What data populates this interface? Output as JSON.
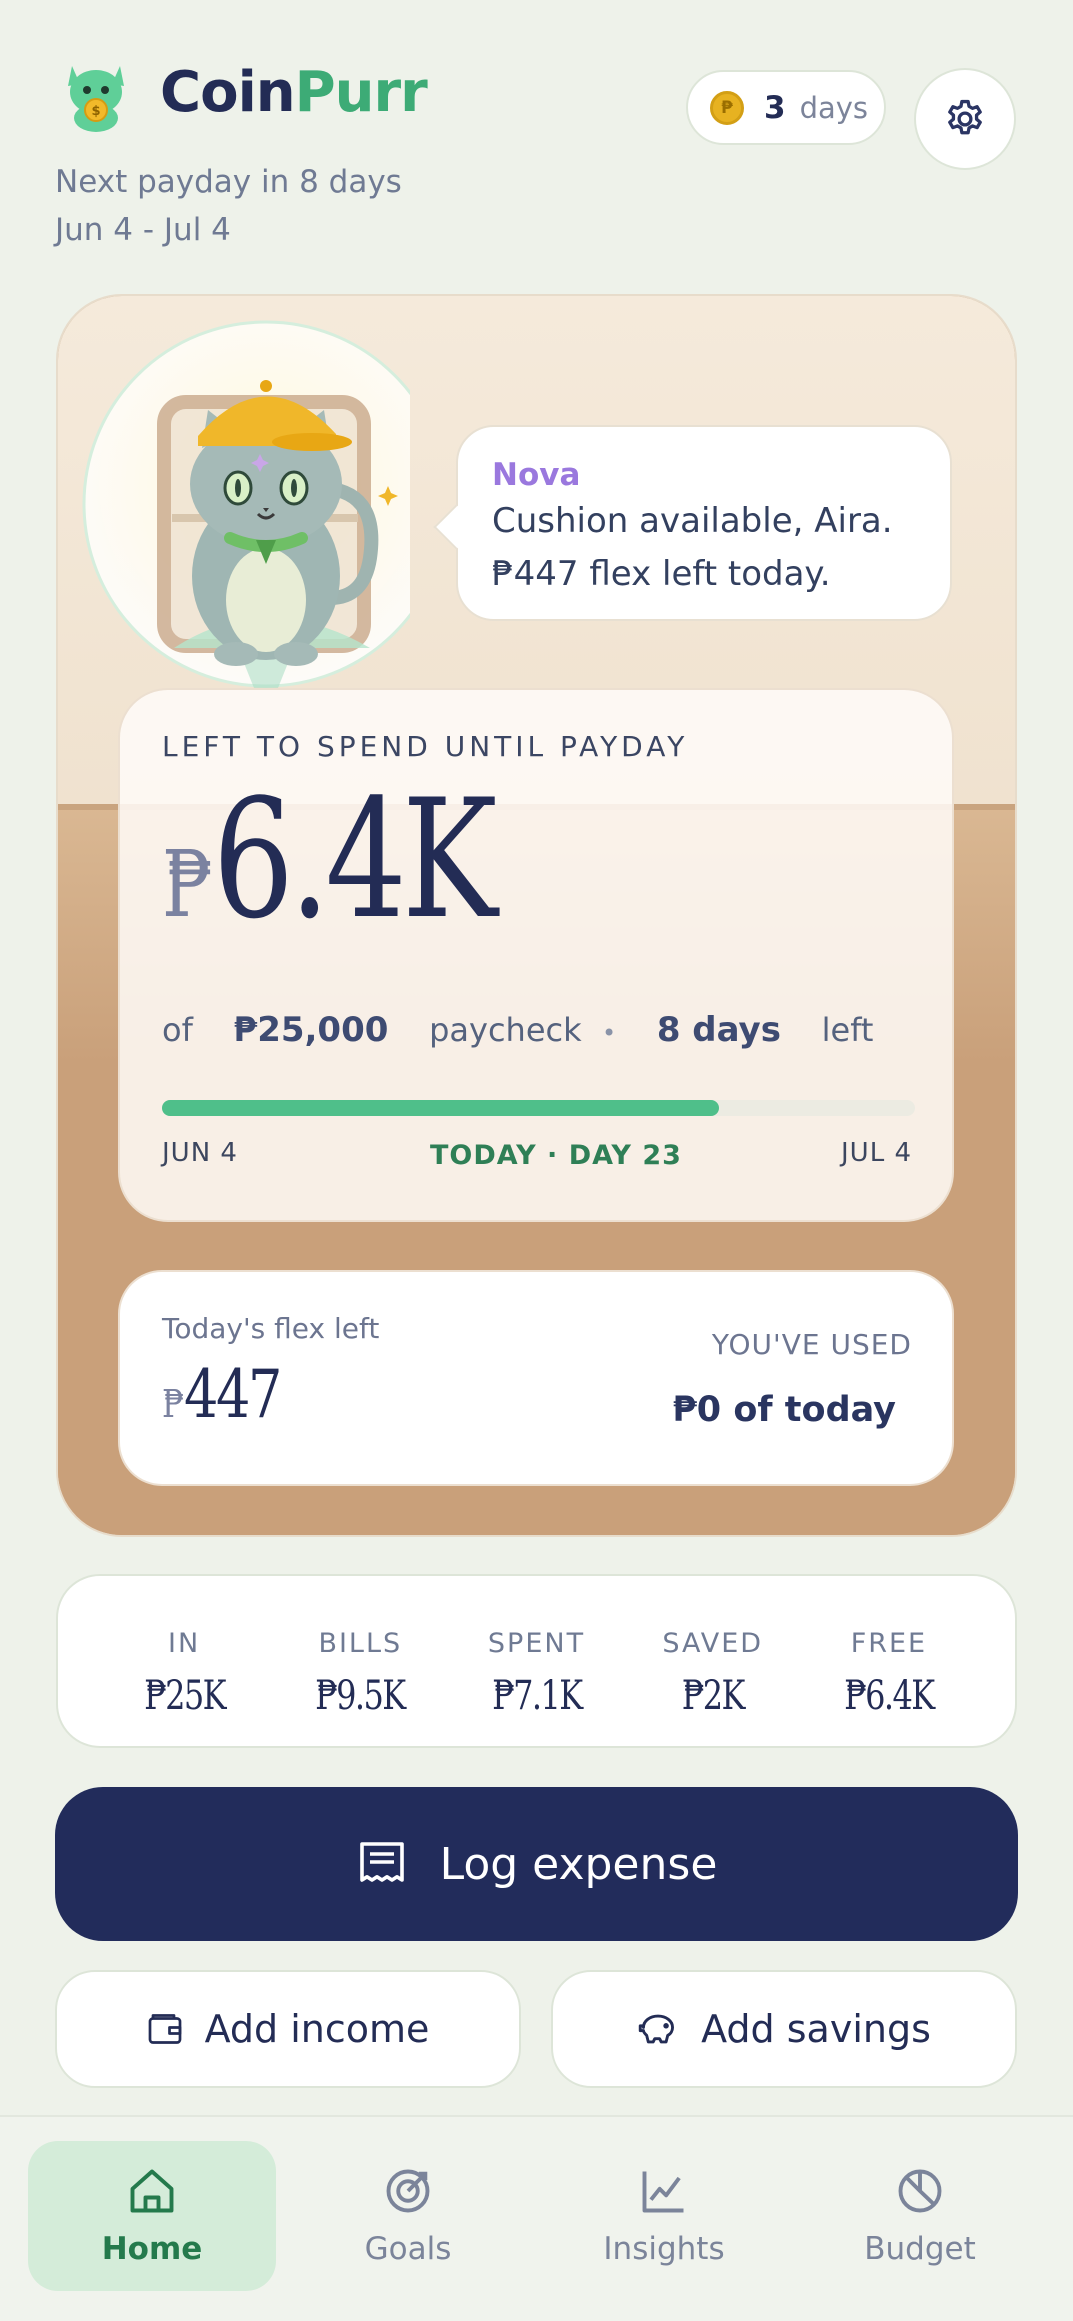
{
  "header": {
    "brand_left": "Coin",
    "brand_right": "Purr",
    "payday_text": "Next payday in 8 days",
    "date_range": "Jun 4 - Jul 4",
    "streak_count": "3",
    "streak_label": "days",
    "icons": {
      "logo": "cat-coin-logo",
      "coin": "coin-icon",
      "settings": "gear-icon"
    }
  },
  "mascot": {
    "name": "Nova",
    "message_line1": "Cushion available, Aira.",
    "message_line2": "₱447 flex left today."
  },
  "spend": {
    "title": "LEFT TO SPEND UNTIL PAYDAY",
    "currency": "₱",
    "amount": "6.4K",
    "of": "of",
    "paycheck": "₱25,000",
    "paycheck_label": "paycheck",
    "bullet": "•",
    "days_left": "8 days",
    "left_label": "left",
    "progress": 0.74,
    "start_label": "JUN 4",
    "today_label": "TODAY · DAY 23",
    "end_label": "JUL 4"
  },
  "flex": {
    "label": "Today's flex left",
    "currency": "₱",
    "amount": "447",
    "used_label": "YOU'VE USED",
    "used_value": "₱0 of today"
  },
  "stats": [
    {
      "label": "IN",
      "value": "₱25K"
    },
    {
      "label": "BILLS",
      "value": "₱9.5K"
    },
    {
      "label": "SPENT",
      "value": "₱7.1K"
    },
    {
      "label": "SAVED",
      "value": "₱2K"
    },
    {
      "label": "FREE",
      "value": "₱6.4K"
    }
  ],
  "actions": {
    "log_expense": "Log expense",
    "add_income": "Add income",
    "add_savings": "Add savings"
  },
  "nav": [
    {
      "label": "Home",
      "icon": "home-icon",
      "active": true
    },
    {
      "label": "Goals",
      "icon": "target-icon",
      "active": false
    },
    {
      "label": "Insights",
      "icon": "chart-icon",
      "active": false
    },
    {
      "label": "Budget",
      "icon": "pie-icon",
      "active": false
    }
  ],
  "colors": {
    "background": "#eef2ea",
    "navy": "#222c5b",
    "brand_green": "#3dab76",
    "progress_green": "#4fbf8a",
    "mascot_name": "#9a78de",
    "hero_floor": "#c9a07a"
  }
}
